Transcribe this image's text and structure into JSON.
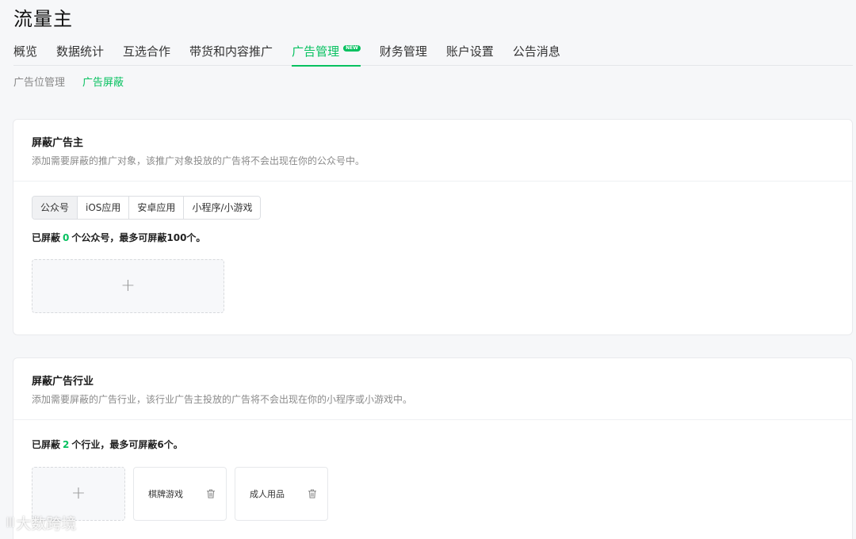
{
  "app": {
    "title": "流量主"
  },
  "main_nav": {
    "tabs": [
      {
        "label": "概览"
      },
      {
        "label": "数据统计"
      },
      {
        "label": "互选合作"
      },
      {
        "label": "带货和内容推广"
      },
      {
        "label": "广告管理",
        "active": true,
        "badge": "NEW"
      },
      {
        "label": "财务管理"
      },
      {
        "label": "账户设置"
      },
      {
        "label": "公告消息"
      }
    ]
  },
  "sub_nav": {
    "tabs": [
      {
        "label": "广告位管理"
      },
      {
        "label": "广告屏蔽",
        "active": true
      }
    ]
  },
  "block_advertiser": {
    "title": "屏蔽广告主",
    "description": "添加需要屏蔽的推广对象，该推广对象投放的广告将不会出现在你的公众号中。",
    "segments": [
      "公众号",
      "iOS应用",
      "安卓应用",
      "小程序/小游戏"
    ],
    "active_segment": "公众号",
    "count_prefix": "已屏蔽",
    "count": "0",
    "count_suffix": "个公众号，最多可屏蔽100个。",
    "add_symbol": "+"
  },
  "block_industry": {
    "title": "屏蔽广告行业",
    "description": "添加需要屏蔽的广告行业，该行业广告主投放的广告将不会出现在你的小程序或小游戏中。",
    "count_prefix": "已屏蔽",
    "count": "2",
    "count_suffix": "个行业，最多可屏蔽6个。",
    "add_symbol": "+",
    "items": [
      {
        "label": "棋牌游戏",
        "icon": "trash-icon"
      },
      {
        "label": "成人用品",
        "icon": "trash-icon"
      }
    ]
  },
  "watermark": {
    "logo": "ꔖ",
    "text": "大数跨境"
  },
  "colors": {
    "accent": "#07c160",
    "background": "#f6f7f9"
  }
}
